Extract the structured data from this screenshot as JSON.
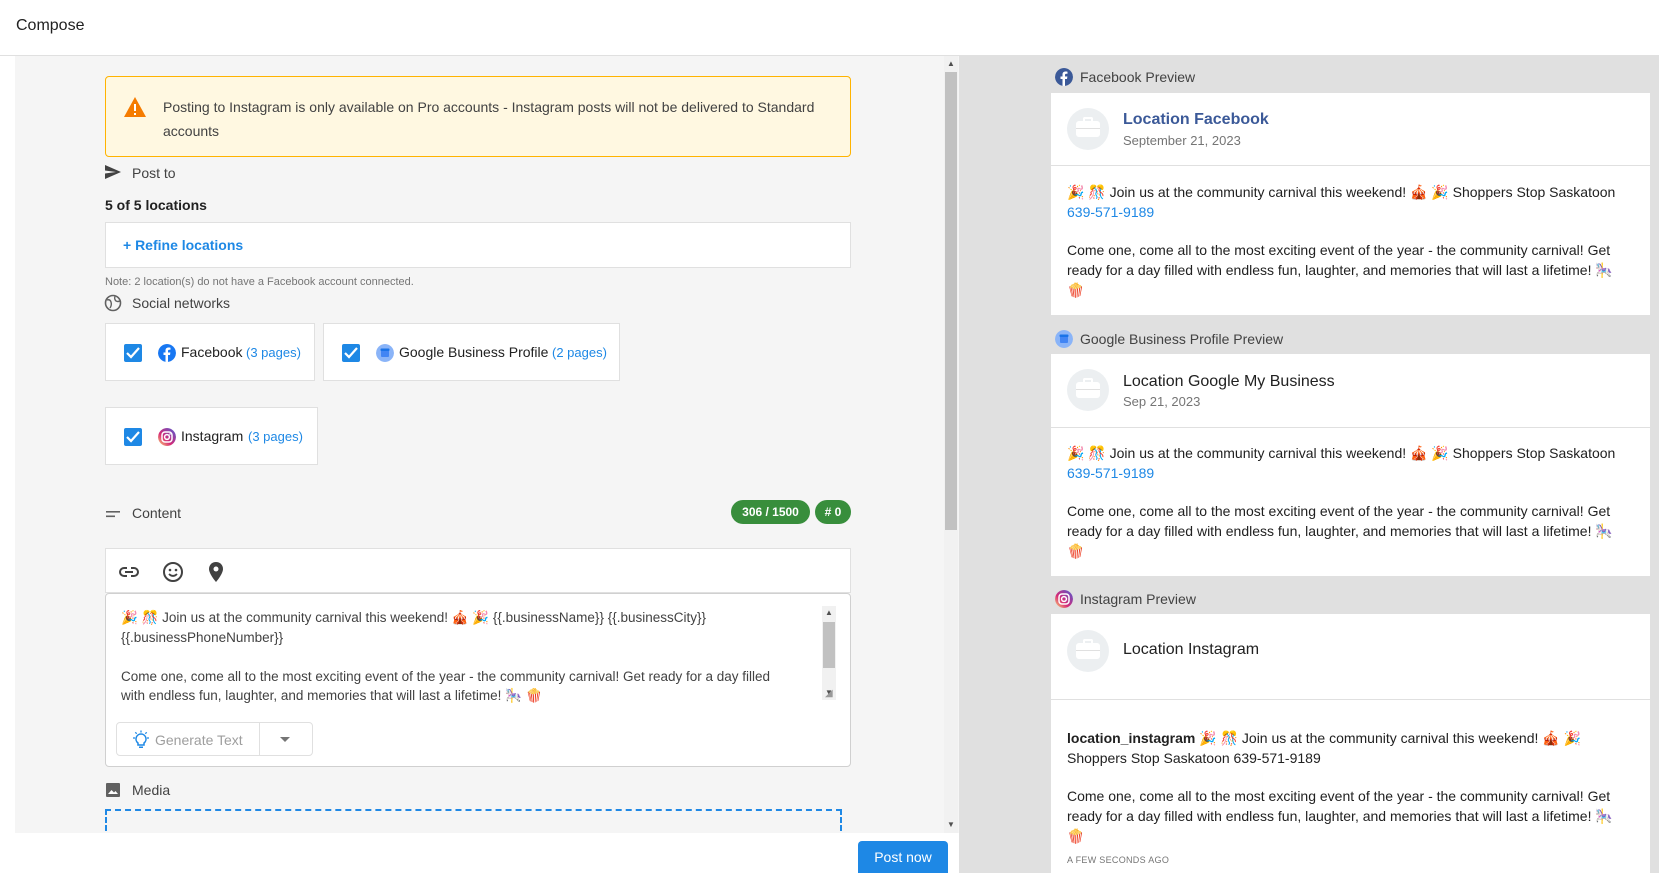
{
  "header": {
    "title": "Compose"
  },
  "warning": {
    "text": "Posting to Instagram is only available on Pro accounts - Instagram posts will not be delivered to Standard accounts"
  },
  "post_to": {
    "label": "Post to",
    "count": "5 of 5 locations",
    "refine_label": "+ Refine locations",
    "note": "Note: 2 location(s) do not have a Facebook account connected."
  },
  "social": {
    "label": "Social networks",
    "networks": [
      {
        "name": "Facebook",
        "pages": "(3 pages)",
        "checked": true
      },
      {
        "name": "Google Business Profile",
        "pages": "(2 pages)",
        "checked": true
      },
      {
        "name": "Instagram",
        "pages": "(3 pages)",
        "checked": true
      }
    ]
  },
  "content": {
    "label": "Content",
    "char_count": "306 / 1500",
    "hashtag_count": "# 0",
    "text_line1": "🎉 🎊 Join us at the community carnival this weekend! 🎪 🎉    {{.businessName}}  {{.businessCity}}",
    "text_line2": "{{.businessPhoneNumber}}",
    "text_line3": "Come one, come all to the most exciting event of the year - the community carnival! Get ready for a day filled",
    "text_line4": "with endless fun, laughter, and memories that will last a lifetime! 🎠 🍿",
    "generate_label": "Generate Text"
  },
  "media": {
    "label": "Media"
  },
  "actions": {
    "post_now": "Post now"
  },
  "previews": {
    "facebook": {
      "heading": "Facebook Preview",
      "name": "Location Facebook",
      "date": "September 21, 2023",
      "line1": "🎉 🎊 Join us at the community carnival this weekend! 🎪 🎉  Shoppers Stop Saskatoon",
      "phone": "639-571-9189",
      "para": "Come one, come all to the most exciting event of the year - the community carnival! Get ready for a day filled with endless fun, laughter, and memories that will last a lifetime! 🎠 🍿"
    },
    "google": {
      "heading": "Google Business Profile Preview",
      "name": "Location Google My Business",
      "date": "Sep 21, 2023",
      "line1": "🎉 🎊 Join us at the community carnival this weekend! 🎪 🎉  Shoppers Stop Saskatoon",
      "phone": "639-571-9189",
      "para": "Come one, come all to the most exciting event of the year - the community carnival! Get ready for a day filled with endless fun, laughter, and memories that will last a lifetime! 🎠 🍿"
    },
    "instagram": {
      "heading": "Instagram Preview",
      "name": "Location Instagram",
      "username": "location_instagram",
      "line1": "  🎉 🎊 Join us at the community carnival this weekend! 🎪 🎉",
      "line2": "Shoppers Stop Saskatoon 639-571-9189",
      "para": "Come one, come all to the most exciting event of the year - the community carnival! Get ready for a day filled with endless fun, laughter, and memories that will last a lifetime! 🎠 🍿",
      "time": "A FEW SECONDS AGO"
    }
  },
  "colors": {
    "accent": "#1e88e5",
    "badge": "#388e3c",
    "warning_bg": "#fff8e1",
    "warning_border": "#ffb300"
  }
}
